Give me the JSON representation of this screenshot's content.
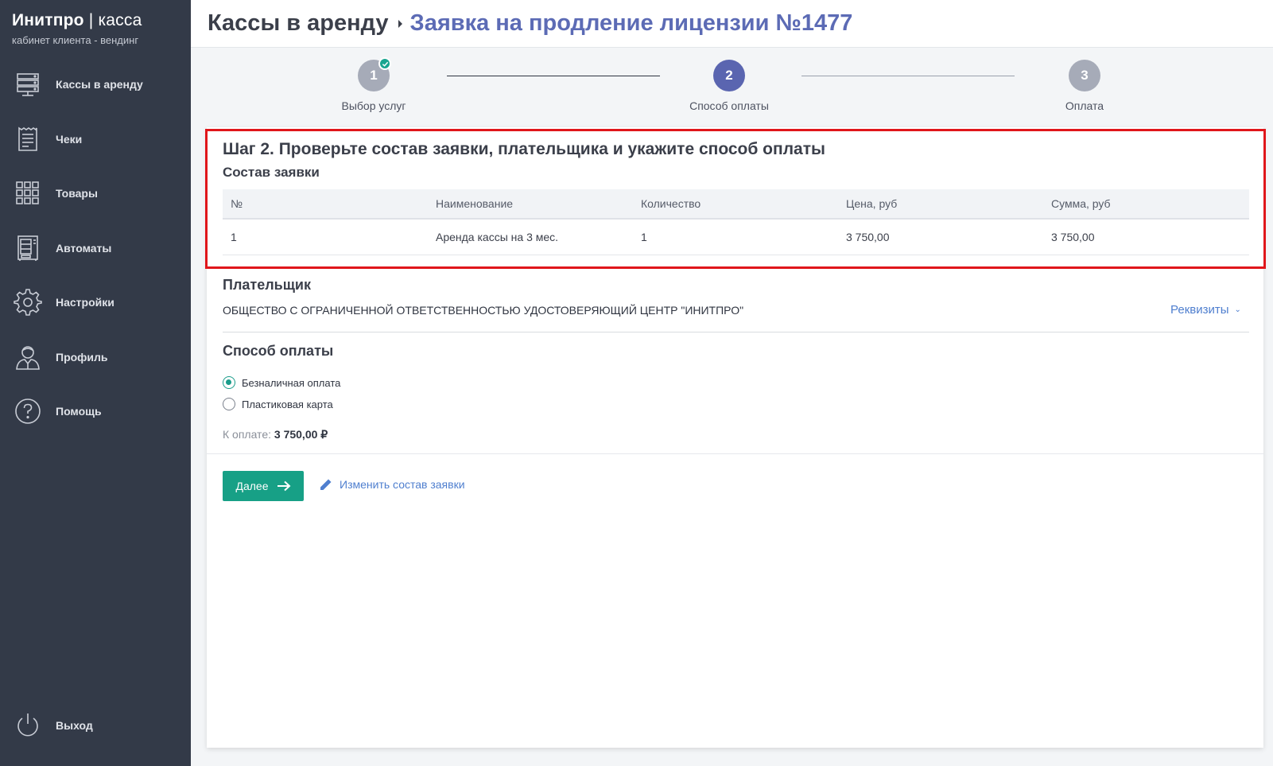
{
  "brand": {
    "title_bold": "Инитпро",
    "title_sep": " | ",
    "title_light": "касса",
    "subtitle": "кабинет клиента - вендинг"
  },
  "sidebar": {
    "items": [
      {
        "label": "Кассы в аренду",
        "icon": "server-icon"
      },
      {
        "label": "Чеки",
        "icon": "receipt-icon"
      },
      {
        "label": "Товары",
        "icon": "grid-icon"
      },
      {
        "label": "Автоматы",
        "icon": "vending-machine-icon"
      },
      {
        "label": "Настройки",
        "icon": "gear-icon"
      },
      {
        "label": "Профиль",
        "icon": "user-icon"
      },
      {
        "label": "Помощь",
        "icon": "help-icon"
      }
    ],
    "logout": {
      "label": "Выход",
      "icon": "power-icon"
    }
  },
  "header": {
    "root": "Кассы в аренду",
    "current": "Заявка на продление лицензии №1477"
  },
  "stepper": {
    "steps": [
      {
        "number": "1",
        "label": "Выбор услуг",
        "state": "done"
      },
      {
        "number": "2",
        "label": "Способ оплаты",
        "state": "active"
      },
      {
        "number": "3",
        "label": "Оплата",
        "state": "pending"
      }
    ]
  },
  "main": {
    "title": "Шаг 2. Проверьте состав заявки, плательщика и укажите способ оплаты",
    "order_section": "Состав заявки",
    "table": {
      "headers": [
        "№",
        "Наименование",
        "Количество",
        "Цена, руб",
        "Сумма, руб"
      ],
      "rows": [
        [
          "1",
          "Аренда кассы на 3 мес.",
          "1",
          "3 750,00",
          "3 750,00"
        ]
      ]
    },
    "payer_section": "Плательщик",
    "payer_name": "ОБЩЕСТВО С ОГРАНИЧЕННОЙ ОТВЕТСТВЕННОСТЬЮ УДОСТОВЕРЯЮЩИЙ ЦЕНТР \"ИНИТПРО\"",
    "requisites_link": "Реквизиты",
    "payment_section": "Способ оплаты",
    "payment_options": [
      {
        "label": "Безналичная оплата",
        "checked": true
      },
      {
        "label": "Пластиковая карта",
        "checked": false
      }
    ],
    "total_label": "К оплате: ",
    "total_value": "3 750,00 ₽",
    "next_button": "Далее",
    "edit_link": "Изменить состав заявки"
  },
  "colors": {
    "sidebar": "#333a48",
    "accent": "#5c6bb5",
    "primary_button": "#17a086",
    "highlight": "#e0161b"
  }
}
